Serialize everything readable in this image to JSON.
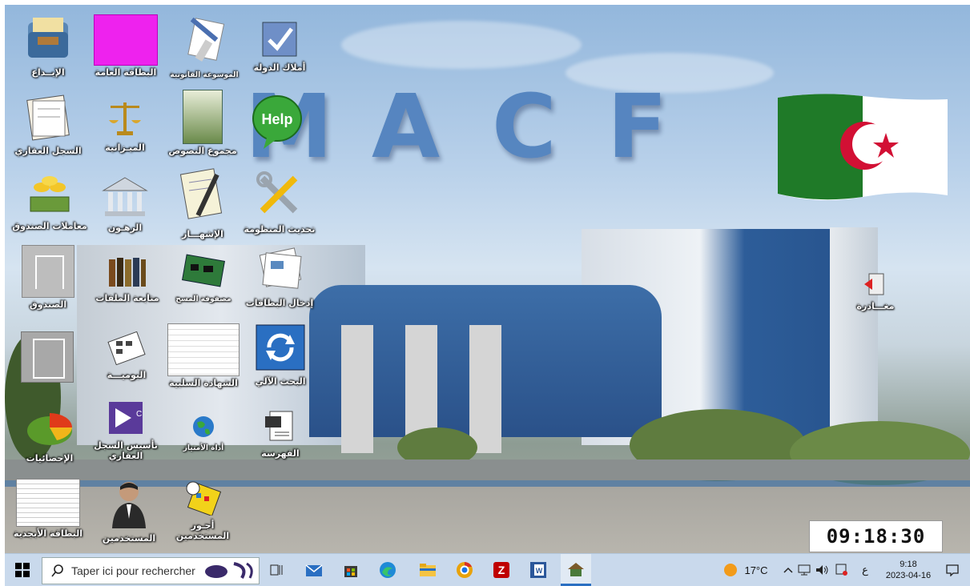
{
  "brand": {
    "letters": [
      "M",
      "A",
      "C",
      "F"
    ]
  },
  "icons": [
    {
      "label": "الإيــداع"
    },
    {
      "label": "البطاقة العامة"
    },
    {
      "label": "الموسوعة القانونية"
    },
    {
      "label": "أملاك الدولة"
    },
    {
      "label": "السجل العقاري"
    },
    {
      "label": "الميـزانية"
    },
    {
      "label": "مجموع النصوص"
    },
    {
      "label": "Help"
    },
    {
      "label": "معاملات الصندوق"
    },
    {
      "label": "الرهـون"
    },
    {
      "label": "الإشهـــار"
    },
    {
      "label": "تحديث المنظومة"
    },
    {
      "label": "الصندوق"
    },
    {
      "label": "متابعة الملفات"
    },
    {
      "label": "مصفوفة المسح"
    },
    {
      "label": "إدخال البطاقات"
    },
    {
      "label": "البوميـــة"
    },
    {
      "label": "الشهادة السلبية"
    },
    {
      "label": "البحث الآلي"
    },
    {
      "label": "الإحصائيات"
    },
    {
      "label": "تأسيس السجل العقاري"
    },
    {
      "label": "أداة الأمتياز"
    },
    {
      "label": "الفهرسة"
    },
    {
      "label": "البطاقة الأبجدية"
    },
    {
      "label": "المستخدمين"
    },
    {
      "label": "أجـور المستخدمين"
    },
    {
      "label": "مغـــادرة"
    }
  ],
  "clock": {
    "time": "09:18:30"
  },
  "taskbar": {
    "search_placeholder": "Taper ici pour rechercher",
    "weather": "17°C",
    "lang": "ع",
    "time": "9:18",
    "date": "2023-04-16"
  },
  "colors": {
    "taskbar": "#c9d9ec",
    "macf": "#4f80bd",
    "flag_green": "#1f7a28",
    "flag_red": "#d21034"
  }
}
